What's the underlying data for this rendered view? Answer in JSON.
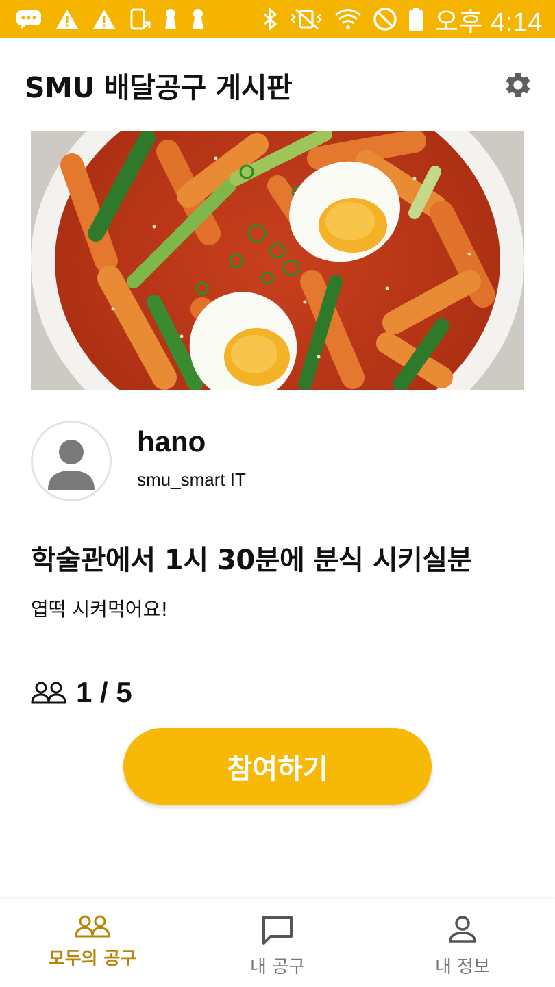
{
  "status_bar": {
    "time": "오후 4:14",
    "left_icons": [
      "chat-bubble-icon",
      "warning-icon",
      "warning-icon",
      "screen-rotate-icon",
      "keyhole-icon",
      "keyhole-icon"
    ],
    "right_icons": [
      "bluetooth-icon",
      "vibrate-icon",
      "wifi-icon",
      "do-not-disturb-icon",
      "battery-icon"
    ],
    "color": "#f5b400"
  },
  "app_bar": {
    "title": "SMU 배달공구 게시판",
    "settings_icon": "gear-icon"
  },
  "post": {
    "image": "tteokbokki-photo",
    "author": {
      "name": "hano",
      "department": "smu_smart IT"
    },
    "title": "학술관에서 1시 30분에 분식 시키실분",
    "body": "엽떡 시켜먹어요!",
    "participants": {
      "icon": "people-icon",
      "text": "1 / 5"
    },
    "join_label": "참여하기"
  },
  "bottom_nav": {
    "items": [
      {
        "label": "모두의 공구",
        "icon": "people-icon",
        "active": true
      },
      {
        "label": "내 공구",
        "icon": "chat-icon",
        "active": false
      },
      {
        "label": "내 정보",
        "icon": "person-icon",
        "active": false
      }
    ],
    "active_color": "#b8860b"
  },
  "colors": {
    "accent": "#f8b806",
    "status_bar": "#f5b400",
    "inactive_nav": "#777777"
  }
}
